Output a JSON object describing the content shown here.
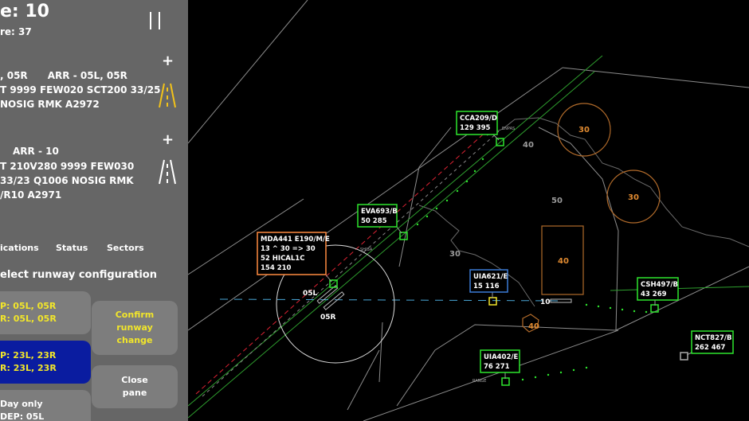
{
  "header": {
    "score_line": "e: 10",
    "sub_line": "re: 37"
  },
  "airport_1": {
    "runways_line": ", 05R      ARR - 05L, 05R",
    "metar_1": "T 9999 FEW020 SCT200 33/25",
    "metar_2": "NOSIG RMK A2972",
    "add": "+"
  },
  "airport_2": {
    "runways_line": "ARR - 10",
    "metar_1": "T 210V280 9999 FEW030",
    "metar_2": "33/23 Q1006 NOSIG RMK",
    "metar_3": "/R10 A2971",
    "add": "+"
  },
  "tabs": [
    "ications",
    "Status",
    "Sectors"
  ],
  "section_title": "elect runway configuration",
  "configs": [
    {
      "line1": "P: 05L, 05R",
      "line2": "R: 05L, 05R"
    },
    {
      "line1": "P: 23L, 23R",
      "line2": "R: 23L, 23R"
    },
    {
      "line1": "Day only",
      "line2": "DEP: 05L"
    }
  ],
  "actions": {
    "confirm_1": "Confirm",
    "confirm_2": "runway",
    "confirm_3": "change",
    "close_1": "Close",
    "close_2": "pane"
  },
  "colors": {
    "panel": "#666666",
    "selected": "#0a1ca0",
    "highlight": "#f2e62a",
    "tag_normal": "#2ee62e",
    "tag_selected": "#ff8a40",
    "tag_arrival": "#3a7bd5"
  },
  "map": {
    "altitude_labels": [
      "40",
      "50",
      "30",
      "30",
      "30",
      "40",
      "40"
    ],
    "runway_labels": [
      "05L",
      "05R",
      "10"
    ],
    "fixes": [
      "ENPAS",
      "SHIBA",
      "RANGE"
    ]
  },
  "aircraft": [
    {
      "callsign": "CCA209/D",
      "data": "129 395"
    },
    {
      "callsign": "EVA693/B",
      "data": "50 285"
    },
    {
      "callsign": "MDA441 E190/M/E",
      "data": "13 ^ 30 => 30",
      "data2": "52 HICAL1C",
      "data3": "154 210"
    },
    {
      "callsign": "UIA621/E",
      "data": "15 116"
    },
    {
      "callsign": "CSH497/B",
      "data": "43 269"
    },
    {
      "callsign": "UIA402/E",
      "data": "76 271"
    },
    {
      "callsign": "NCT827/B",
      "data": "262 467"
    }
  ]
}
